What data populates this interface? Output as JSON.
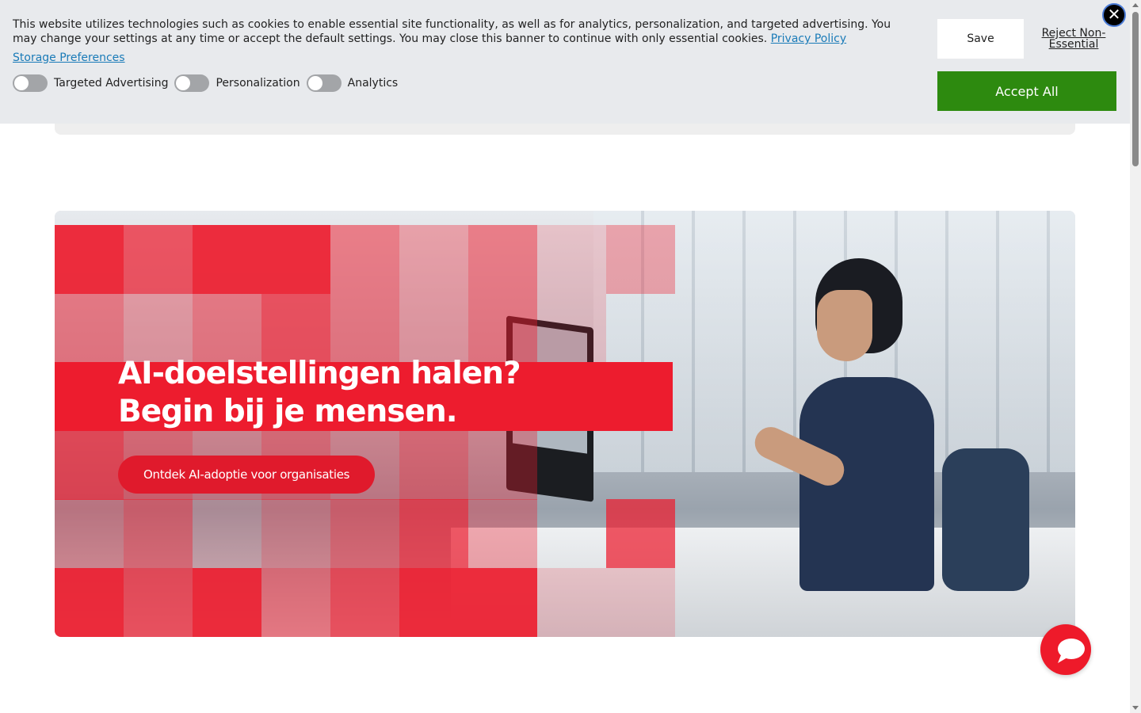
{
  "cookie_banner": {
    "text": "This website utilizes technologies such as cookies to enable essential site functionality, as well as for analytics, personalization, and targeted advertising. You may change your settings at any time or accept the default settings. You may close this banner to continue with only essential cookies.",
    "privacy_link": "Privacy Policy",
    "storage_link": "Storage Preferences",
    "toggles": [
      {
        "label": "Targeted Advertising",
        "on": false
      },
      {
        "label": "Personalization",
        "on": false
      },
      {
        "label": "Analytics",
        "on": false
      }
    ],
    "save_label": "Save",
    "reject_label": "Reject Non-Essential",
    "accept_label": "Accept All",
    "close_icon": "close-icon",
    "accent_color": "#2d8a0f"
  },
  "hero": {
    "title_line1": "AI-doelstellingen halen?",
    "title_line2": "Begin bij je mensen.",
    "cta_label": "Ontdek AI-adoptie voor organisaties",
    "brand_color": "#ed1c2e"
  },
  "chat": {
    "icon": "chat-bubble-icon"
  }
}
